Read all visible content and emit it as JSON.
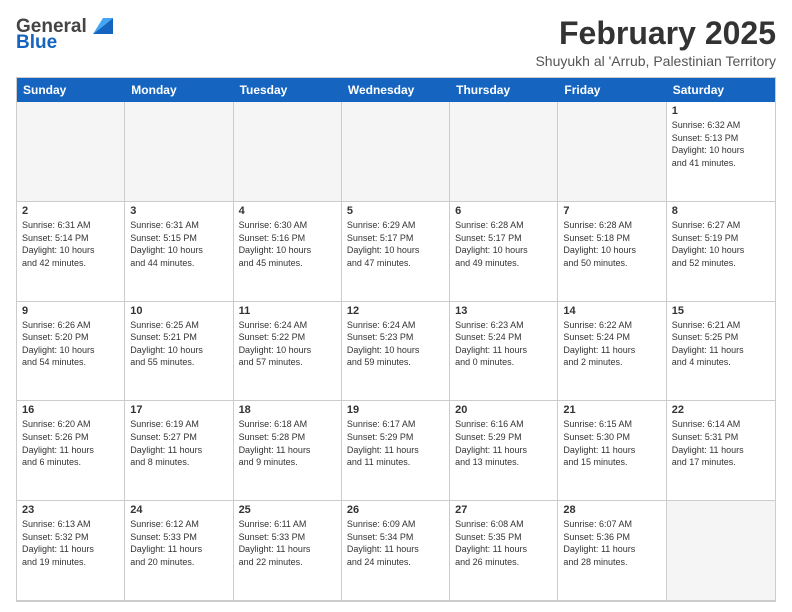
{
  "logo": {
    "general": "General",
    "blue": "Blue"
  },
  "title": "February 2025",
  "subtitle": "Shuyukh al 'Arrub, Palestinian Territory",
  "headers": [
    "Sunday",
    "Monday",
    "Tuesday",
    "Wednesday",
    "Thursday",
    "Friday",
    "Saturday"
  ],
  "weeks": [
    [
      {
        "num": "",
        "empty": true,
        "info": ""
      },
      {
        "num": "",
        "empty": true,
        "info": ""
      },
      {
        "num": "",
        "empty": true,
        "info": ""
      },
      {
        "num": "",
        "empty": true,
        "info": ""
      },
      {
        "num": "",
        "empty": true,
        "info": ""
      },
      {
        "num": "",
        "empty": true,
        "info": ""
      },
      {
        "num": "1",
        "empty": false,
        "info": "Sunrise: 6:32 AM\nSunset: 5:13 PM\nDaylight: 10 hours\nand 41 minutes."
      }
    ],
    [
      {
        "num": "2",
        "empty": false,
        "info": "Sunrise: 6:31 AM\nSunset: 5:14 PM\nDaylight: 10 hours\nand 42 minutes."
      },
      {
        "num": "3",
        "empty": false,
        "info": "Sunrise: 6:31 AM\nSunset: 5:15 PM\nDaylight: 10 hours\nand 44 minutes."
      },
      {
        "num": "4",
        "empty": false,
        "info": "Sunrise: 6:30 AM\nSunset: 5:16 PM\nDaylight: 10 hours\nand 45 minutes."
      },
      {
        "num": "5",
        "empty": false,
        "info": "Sunrise: 6:29 AM\nSunset: 5:17 PM\nDaylight: 10 hours\nand 47 minutes."
      },
      {
        "num": "6",
        "empty": false,
        "info": "Sunrise: 6:28 AM\nSunset: 5:17 PM\nDaylight: 10 hours\nand 49 minutes."
      },
      {
        "num": "7",
        "empty": false,
        "info": "Sunrise: 6:28 AM\nSunset: 5:18 PM\nDaylight: 10 hours\nand 50 minutes."
      },
      {
        "num": "8",
        "empty": false,
        "info": "Sunrise: 6:27 AM\nSunset: 5:19 PM\nDaylight: 10 hours\nand 52 minutes."
      }
    ],
    [
      {
        "num": "9",
        "empty": false,
        "info": "Sunrise: 6:26 AM\nSunset: 5:20 PM\nDaylight: 10 hours\nand 54 minutes."
      },
      {
        "num": "10",
        "empty": false,
        "info": "Sunrise: 6:25 AM\nSunset: 5:21 PM\nDaylight: 10 hours\nand 55 minutes."
      },
      {
        "num": "11",
        "empty": false,
        "info": "Sunrise: 6:24 AM\nSunset: 5:22 PM\nDaylight: 10 hours\nand 57 minutes."
      },
      {
        "num": "12",
        "empty": false,
        "info": "Sunrise: 6:24 AM\nSunset: 5:23 PM\nDaylight: 10 hours\nand 59 minutes."
      },
      {
        "num": "13",
        "empty": false,
        "info": "Sunrise: 6:23 AM\nSunset: 5:24 PM\nDaylight: 11 hours\nand 0 minutes."
      },
      {
        "num": "14",
        "empty": false,
        "info": "Sunrise: 6:22 AM\nSunset: 5:24 PM\nDaylight: 11 hours\nand 2 minutes."
      },
      {
        "num": "15",
        "empty": false,
        "info": "Sunrise: 6:21 AM\nSunset: 5:25 PM\nDaylight: 11 hours\nand 4 minutes."
      }
    ],
    [
      {
        "num": "16",
        "empty": false,
        "info": "Sunrise: 6:20 AM\nSunset: 5:26 PM\nDaylight: 11 hours\nand 6 minutes."
      },
      {
        "num": "17",
        "empty": false,
        "info": "Sunrise: 6:19 AM\nSunset: 5:27 PM\nDaylight: 11 hours\nand 8 minutes."
      },
      {
        "num": "18",
        "empty": false,
        "info": "Sunrise: 6:18 AM\nSunset: 5:28 PM\nDaylight: 11 hours\nand 9 minutes."
      },
      {
        "num": "19",
        "empty": false,
        "info": "Sunrise: 6:17 AM\nSunset: 5:29 PM\nDaylight: 11 hours\nand 11 minutes."
      },
      {
        "num": "20",
        "empty": false,
        "info": "Sunrise: 6:16 AM\nSunset: 5:29 PM\nDaylight: 11 hours\nand 13 minutes."
      },
      {
        "num": "21",
        "empty": false,
        "info": "Sunrise: 6:15 AM\nSunset: 5:30 PM\nDaylight: 11 hours\nand 15 minutes."
      },
      {
        "num": "22",
        "empty": false,
        "info": "Sunrise: 6:14 AM\nSunset: 5:31 PM\nDaylight: 11 hours\nand 17 minutes."
      }
    ],
    [
      {
        "num": "23",
        "empty": false,
        "info": "Sunrise: 6:13 AM\nSunset: 5:32 PM\nDaylight: 11 hours\nand 19 minutes."
      },
      {
        "num": "24",
        "empty": false,
        "info": "Sunrise: 6:12 AM\nSunset: 5:33 PM\nDaylight: 11 hours\nand 20 minutes."
      },
      {
        "num": "25",
        "empty": false,
        "info": "Sunrise: 6:11 AM\nSunset: 5:33 PM\nDaylight: 11 hours\nand 22 minutes."
      },
      {
        "num": "26",
        "empty": false,
        "info": "Sunrise: 6:09 AM\nSunset: 5:34 PM\nDaylight: 11 hours\nand 24 minutes."
      },
      {
        "num": "27",
        "empty": false,
        "info": "Sunrise: 6:08 AM\nSunset: 5:35 PM\nDaylight: 11 hours\nand 26 minutes."
      },
      {
        "num": "28",
        "empty": false,
        "info": "Sunrise: 6:07 AM\nSunset: 5:36 PM\nDaylight: 11 hours\nand 28 minutes."
      },
      {
        "num": "",
        "empty": true,
        "info": ""
      }
    ]
  ]
}
